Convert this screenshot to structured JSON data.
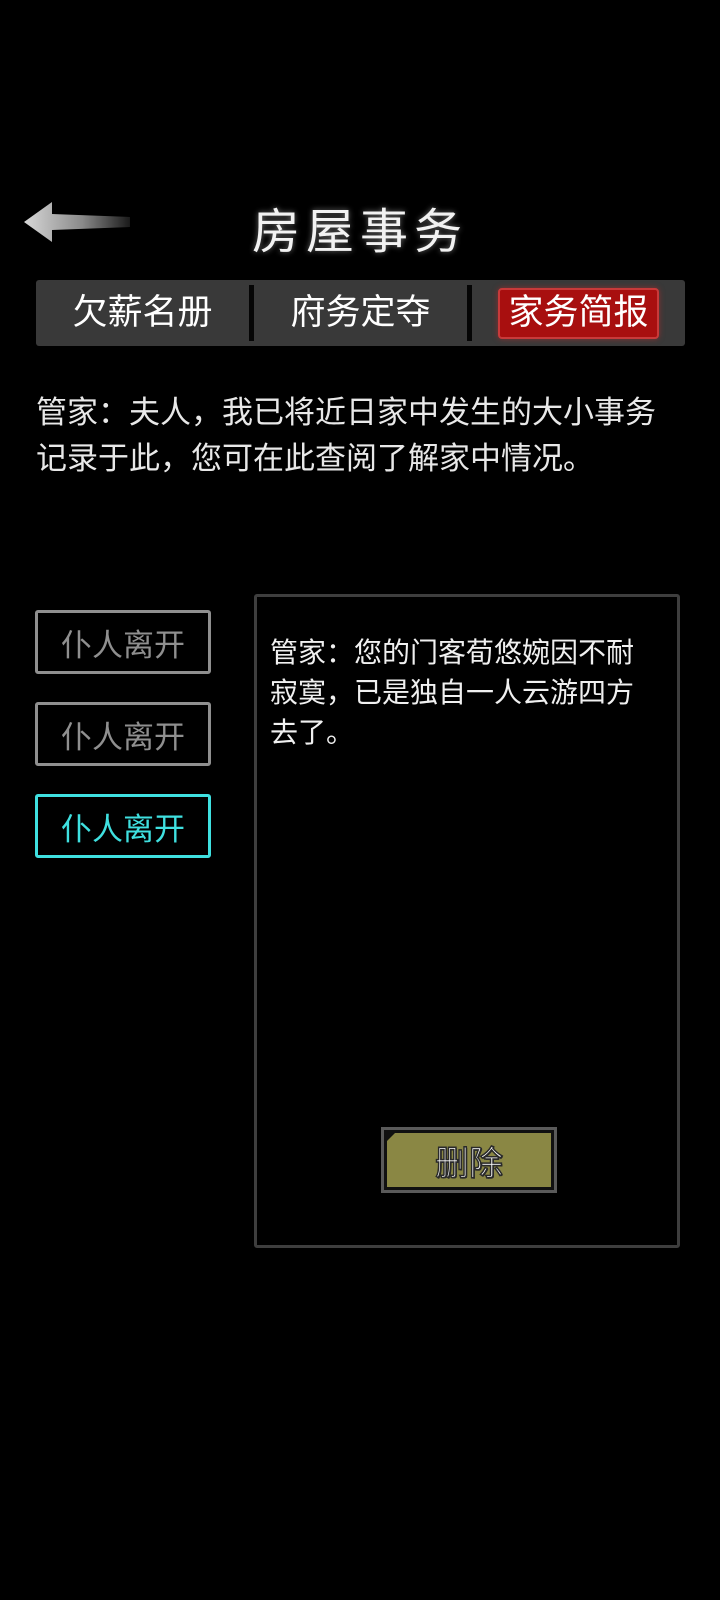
{
  "header": {
    "title": "房屋事务",
    "back_icon": "left-arrow-icon"
  },
  "tabs": [
    {
      "label": "欠薪名册",
      "active": false
    },
    {
      "label": "府务定夺",
      "active": false
    },
    {
      "label": "家务简报",
      "active": true
    }
  ],
  "intro": {
    "text": "管家：夫人，我已将近日家中发生的大小事务记录于此，您可在此查阅了解家中情况。"
  },
  "list": {
    "items": [
      {
        "label": "仆人离开",
        "selected": false
      },
      {
        "label": "仆人离开",
        "selected": false
      },
      {
        "label": "仆人离开",
        "selected": true
      }
    ]
  },
  "detail": {
    "text": "管家：您的门客荀悠婉因不耐寂寞，已是独自一人云游四方去了。",
    "delete_label": "删除"
  },
  "colors": {
    "background": "#000000",
    "tab_bar": "#393939",
    "active_tab": "#a80f0f",
    "selected_item": "#3fe0e0",
    "unselected_item": "#8f8f8f",
    "delete_button": "#8a8744"
  }
}
